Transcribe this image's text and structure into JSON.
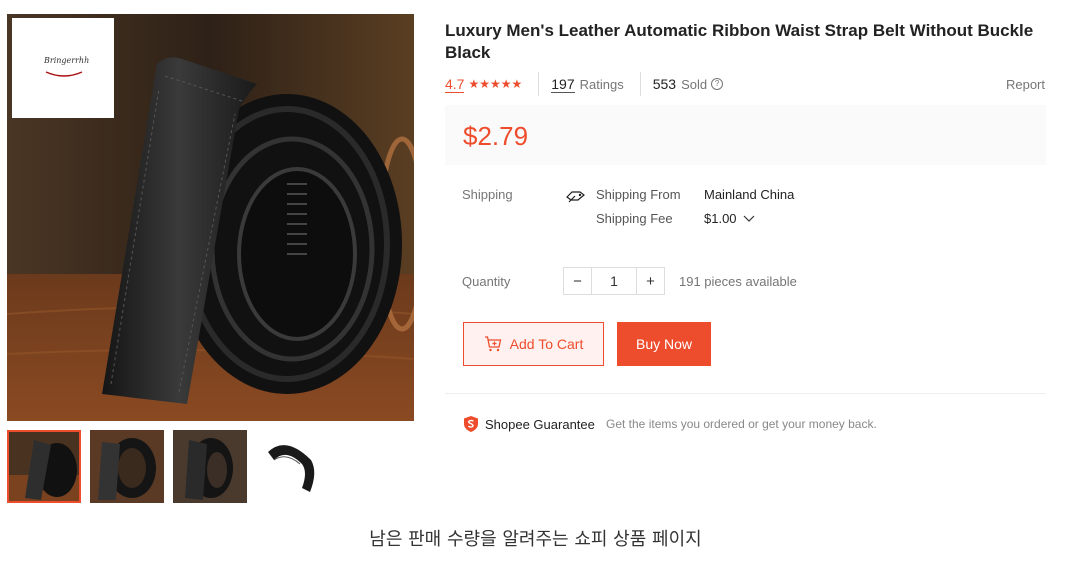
{
  "product": {
    "title": "Luxury Men's Leather Automatic Ribbon Waist Strap Belt Without Buckle Black",
    "rating": "4.7",
    "stars": "★★★★★",
    "ratings_count": "197",
    "ratings_label": "Ratings",
    "sold_count": "553",
    "sold_label": "Sold",
    "report_label": "Report",
    "price": "$2.79"
  },
  "gallery": {
    "logo_text": "Bringerrhh",
    "thumbnail_count": 4,
    "active_thumbnail": 0
  },
  "shipping": {
    "label": "Shipping",
    "from_label": "Shipping From",
    "from_value": "Mainland China",
    "fee_label": "Shipping Fee",
    "fee_value": "$1.00"
  },
  "quantity": {
    "label": "Quantity",
    "minus": "−",
    "value": "1",
    "plus": "+",
    "available": "191 pieces available"
  },
  "actions": {
    "add_to_cart": "Add To Cart",
    "buy_now": "Buy Now"
  },
  "guarantee": {
    "label": "Shopee Guarantee",
    "text": "Get the items you ordered or get your money back."
  },
  "caption": "남은 판매 수량을 알려주는 쇼피 상품 페이지",
  "colors": {
    "accent": "#ee4d2d",
    "price_bg": "#fafafa",
    "cart_bg": "#fff1ef"
  },
  "icons": {
    "star": "star-icon",
    "help": "question-circle-icon",
    "truck": "truck-icon",
    "chevron": "chevron-down-icon",
    "cart": "add-cart-icon",
    "shield": "shield-icon"
  }
}
